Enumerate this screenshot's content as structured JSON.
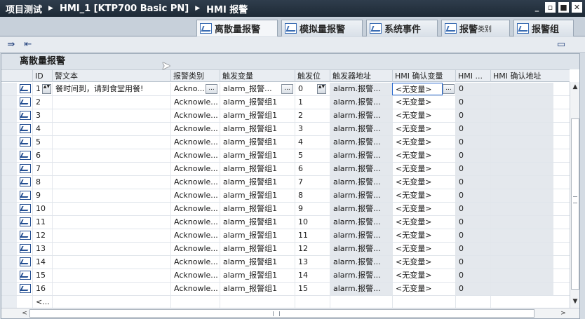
{
  "titlebar": {
    "crumbs": [
      "项目测试",
      "HMI_1 [KTP700 Basic PN]",
      "HMI 报警"
    ],
    "minimize": "_",
    "restore": "▫",
    "maximize": "■",
    "close": "✕"
  },
  "tabs": [
    {
      "label": "离散量报警",
      "active": true
    },
    {
      "label": "模拟量报警",
      "active": false
    },
    {
      "label": "系统事件",
      "active": false
    },
    {
      "label": "报警",
      "suffix": "类别",
      "active": false
    },
    {
      "label": "报警组",
      "active": false
    }
  ],
  "toolbar": {
    "icon_insert": "⇛",
    "icon_export": "⇤",
    "icon_right": "▭"
  },
  "editor": {
    "title": "离散量报警"
  },
  "columns": [
    "ID",
    "警文本",
    "报警类别",
    "触发变量",
    "触发位",
    "触发器地址",
    "HMI 确认变量",
    "HMI ...",
    "HMI 确认地址"
  ],
  "rows": [
    {
      "id": "1",
      "text": "餐时间到，请到食堂用餐!",
      "cls": "Ackno...",
      "var": "alarm_报警...",
      "bit": "0",
      "addr": "alarm.报警...",
      "ack": "<无变量>",
      "hmi": "0"
    },
    {
      "id": "2",
      "text": "",
      "cls": "Acknowle...",
      "var": "alarm_报警组1",
      "bit": "1",
      "addr": "alarm.报警...",
      "ack": "<无变量>",
      "hmi": "0"
    },
    {
      "id": "3",
      "text": "",
      "cls": "Acknowle...",
      "var": "alarm_报警组1",
      "bit": "2",
      "addr": "alarm.报警...",
      "ack": "<无变量>",
      "hmi": "0"
    },
    {
      "id": "4",
      "text": "",
      "cls": "Acknowle...",
      "var": "alarm_报警组1",
      "bit": "3",
      "addr": "alarm.报警...",
      "ack": "<无变量>",
      "hmi": "0"
    },
    {
      "id": "5",
      "text": "",
      "cls": "Acknowle...",
      "var": "alarm_报警组1",
      "bit": "4",
      "addr": "alarm.报警...",
      "ack": "<无变量>",
      "hmi": "0"
    },
    {
      "id": "6",
      "text": "",
      "cls": "Acknowle...",
      "var": "alarm_报警组1",
      "bit": "5",
      "addr": "alarm.报警...",
      "ack": "<无变量>",
      "hmi": "0"
    },
    {
      "id": "7",
      "text": "",
      "cls": "Acknowle...",
      "var": "alarm_报警组1",
      "bit": "6",
      "addr": "alarm.报警...",
      "ack": "<无变量>",
      "hmi": "0"
    },
    {
      "id": "8",
      "text": "",
      "cls": "Acknowle...",
      "var": "alarm_报警组1",
      "bit": "7",
      "addr": "alarm.报警...",
      "ack": "<无变量>",
      "hmi": "0"
    },
    {
      "id": "9",
      "text": "",
      "cls": "Acknowle...",
      "var": "alarm_报警组1",
      "bit": "8",
      "addr": "alarm.报警...",
      "ack": "<无变量>",
      "hmi": "0"
    },
    {
      "id": "10",
      "text": "",
      "cls": "Acknowle...",
      "var": "alarm_报警组1",
      "bit": "9",
      "addr": "alarm.报警...",
      "ack": "<无变量>",
      "hmi": "0"
    },
    {
      "id": "11",
      "text": "",
      "cls": "Acknowle...",
      "var": "alarm_报警组1",
      "bit": "10",
      "addr": "alarm.报警...",
      "ack": "<无变量>",
      "hmi": "0"
    },
    {
      "id": "12",
      "text": "",
      "cls": "Acknowle...",
      "var": "alarm_报警组1",
      "bit": "11",
      "addr": "alarm.报警...",
      "ack": "<无变量>",
      "hmi": "0"
    },
    {
      "id": "13",
      "text": "",
      "cls": "Acknowle...",
      "var": "alarm_报警组1",
      "bit": "12",
      "addr": "alarm.报警...",
      "ack": "<无变量>",
      "hmi": "0"
    },
    {
      "id": "14",
      "text": "",
      "cls": "Acknowle...",
      "var": "alarm_报警组1",
      "bit": "13",
      "addr": "alarm.报警...",
      "ack": "<无变量>",
      "hmi": "0"
    },
    {
      "id": "15",
      "text": "",
      "cls": "Acknowle...",
      "var": "alarm_报警组1",
      "bit": "14",
      "addr": "alarm.报警...",
      "ack": "<无变量>",
      "hmi": "0"
    },
    {
      "id": "16",
      "text": "",
      "cls": "Acknowle...",
      "var": "alarm_报警组1",
      "bit": "15",
      "addr": "alarm.报警...",
      "ack": "<无变量>",
      "hmi": "0"
    },
    {
      "id": "<...",
      "text": "",
      "cls": "",
      "var": "",
      "bit": "",
      "addr": "",
      "ack": "",
      "hmi": ""
    }
  ],
  "buttons": {
    "ellipsis": "...",
    "spin": "▲▼"
  },
  "scroll": {
    "up": "▲",
    "down": "▼",
    "left": "<",
    "right": ">"
  }
}
